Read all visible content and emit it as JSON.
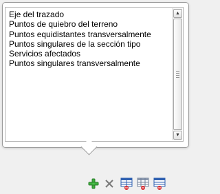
{
  "popup": {
    "items": [
      "Eje del trazado",
      "Puntos de quiebro del terreno",
      "Puntos equidistantes transversalmente",
      "Puntos singulares de la sección tipo",
      "Servicios afectados",
      "Puntos singulares transversalmente"
    ]
  },
  "scrollbar": {
    "up_icon": "arrow-up-icon",
    "down_icon": "arrow-down-icon"
  },
  "toolbar": {
    "buttons": [
      {
        "icon": "add-icon",
        "color": "#3fae3f"
      },
      {
        "icon": "remove-icon",
        "color": "#7a7a7a"
      },
      {
        "icon": "table-remove-icon",
        "color": "#2d5fb0"
      },
      {
        "icon": "table-grid-remove-icon",
        "color": "#6f7f99"
      },
      {
        "icon": "table-list-remove-icon",
        "color": "#2d5fb0"
      }
    ]
  }
}
